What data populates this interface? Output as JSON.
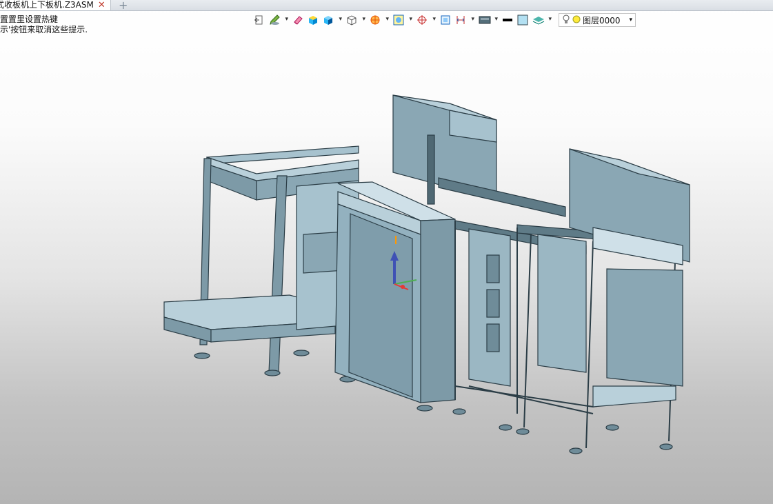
{
  "tab": {
    "title": "式收板机上下板机.Z3ASM",
    "close": "✕",
    "add": "+"
  },
  "hint": {
    "line1": "置置里设置热键",
    "line2": "示'按钮来取消这些提示."
  },
  "layer": {
    "label": "图层0000"
  },
  "toolbar": {
    "icons": [
      "exit-icon",
      "pencil-paint-icon",
      "eraser-icon",
      "shaded-cube-icon",
      "shaded-blue-cube-icon",
      "wireframe-cube-icon",
      "section-view-icon",
      "view-filter-icon",
      "origin-axis-icon",
      "fit-view-icon",
      "dimension-icon",
      "display-style-icon",
      "line-color-icon",
      "fill-color-icon",
      "layer-stack-icon",
      "bulb-icon",
      "layer-color-icon"
    ]
  },
  "colors": {
    "model_face": "#93b1bf",
    "model_dark": "#6f8c99",
    "model_edge": "#2b3d46",
    "accent_red": "#c0392b"
  }
}
